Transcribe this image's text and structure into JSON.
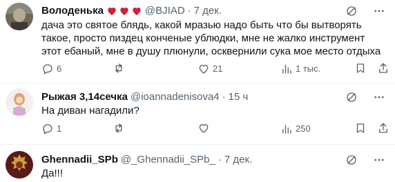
{
  "colors": {
    "text": "#0f1419",
    "secondary": "#536471",
    "heart": "#d1203a",
    "divider": "#eff3f4"
  },
  "tweets": [
    {
      "name": "Володенька",
      "emoji": "heart-icon x3",
      "handle": "@BJIAD",
      "sep": "·",
      "date": "7 дек.",
      "text": "дача это святое блядь, какой мразью надо быть что бы вытворять такое, просто пиздец конченые ублюдки, мне не жалко инструмент этот ебаный, мне в душу плюнули, осквернили сука мое место отдыха",
      "replies": "6",
      "retweets": "",
      "likes": "21",
      "views": "1 тыс."
    },
    {
      "name": "Рыжая 3,14сечка",
      "handle": "@ioannadenisova4",
      "sep": "·",
      "date": "15 ч",
      "text": "На диван нагадили?",
      "replies": "1",
      "retweets": "",
      "likes": "",
      "views": "250"
    },
    {
      "name": "Ghennadii_SPb",
      "handle": "@_Ghennadii_SPb_",
      "sep": "·",
      "date": "7 дек.",
      "text": "Да!!!"
    }
  ]
}
